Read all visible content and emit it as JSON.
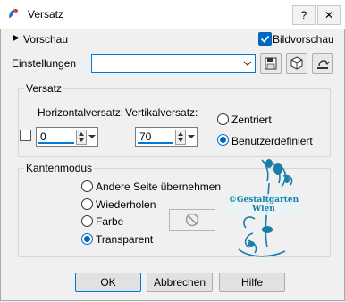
{
  "window": {
    "title": "Versatz"
  },
  "header": {
    "preview_label": "Vorschau",
    "image_preview_label": "Bildvorschau"
  },
  "settings": {
    "label": "Einstellungen",
    "value": ""
  },
  "offset_group": {
    "legend": "Versatz",
    "horizontal_label": "Horizontalversatz:",
    "horizontal_value": "0",
    "vertical_label": "Vertikalversatz:",
    "vertical_value": "70",
    "radio_centered": "Zentriert",
    "radio_custom": "Benutzerdefiniert"
  },
  "edge_group": {
    "legend": "Kantenmodus",
    "opt1": "Andere Seite übernehmen",
    "opt2": "Wiederholen",
    "opt3": "Farbe",
    "opt4": "Transparent"
  },
  "watermark": {
    "line1": "©Gestaltgarten",
    "line2": "Wien"
  },
  "buttons": {
    "ok": "OK",
    "cancel": "Abbrechen",
    "help": "Hilfe"
  },
  "colors": {
    "accent": "#0067c0",
    "watermark": "#1a7fa8"
  }
}
